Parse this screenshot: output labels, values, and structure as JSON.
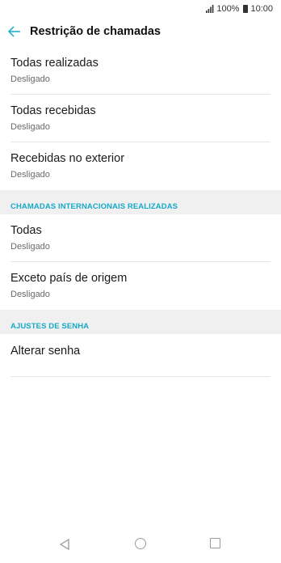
{
  "status": {
    "battery": "100%",
    "time": "10:00"
  },
  "header": {
    "title": "Restrição de chamadas"
  },
  "items_top": [
    {
      "title": "Todas realizadas",
      "status": "Desligado"
    },
    {
      "title": "Todas recebidas",
      "status": "Desligado"
    },
    {
      "title": "Recebidas no exterior",
      "status": "Desligado"
    }
  ],
  "section_international": {
    "label": "CHAMADAS INTERNACIONAIS REALIZADAS"
  },
  "items_international": [
    {
      "title": "Todas",
      "status": "Desligado"
    },
    {
      "title": "Exceto país de origem",
      "status": "Desligado"
    }
  ],
  "section_password": {
    "label": "AJUSTES DE SENHA"
  },
  "items_password": [
    {
      "title": "Alterar senha"
    }
  ],
  "icons": {
    "back": "arrow-left-icon",
    "signal": "signal-icon",
    "battery": "battery-icon",
    "nav_back": "triangle-back-icon",
    "nav_home": "circle-home-icon",
    "nav_recent": "square-recent-icon"
  },
  "colors": {
    "accent": "#16a9c8",
    "section_bg": "#f0f0f0"
  }
}
